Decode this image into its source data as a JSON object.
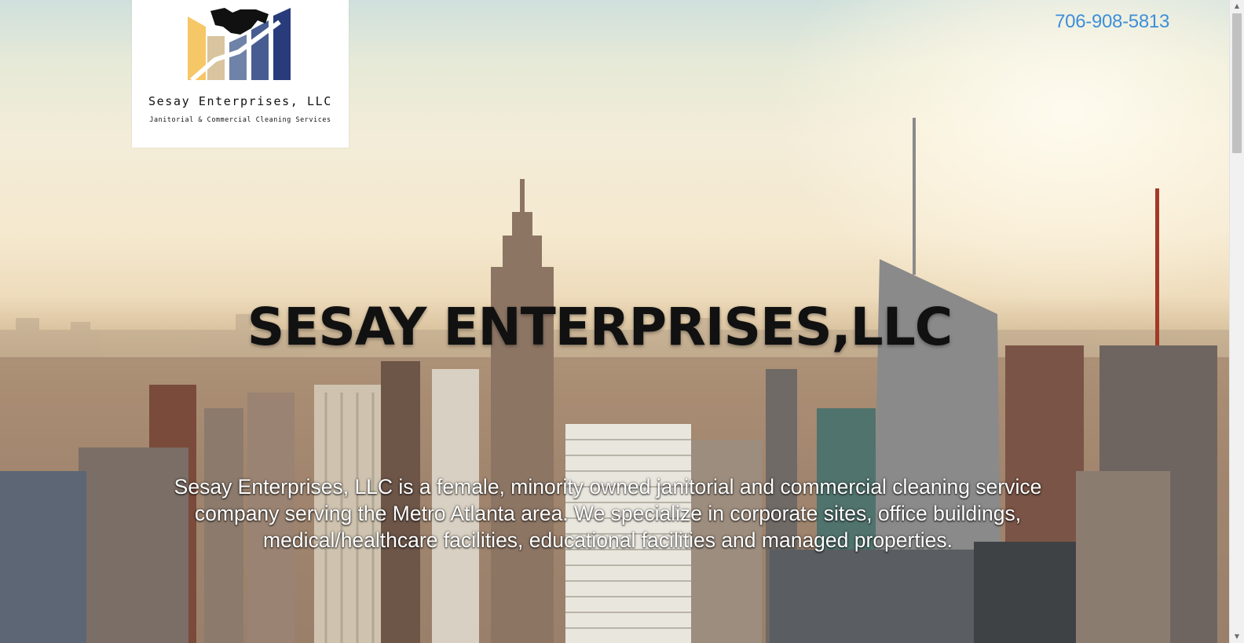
{
  "header": {
    "logo": {
      "company_name": "Sesay Enterprises, LLC",
      "tagline": "Janitorial & Commercial Cleaning Services",
      "icon": "handshake-icon",
      "colors": [
        "#f6c766",
        "#d8c49e",
        "#6f82a8",
        "#475d92",
        "#283b7a"
      ]
    },
    "phone": "706-908-5813"
  },
  "hero": {
    "headline": "SESAY ENTERPRISES,LLC",
    "description": "Sesay Enterprises, LLC is a female, minority owned janitorial and commercial  cleaning service company serving the Metro Atlanta area. We specialize in corporate sites, office buildings, medical/healthcare facilities, educational facilities and managed properties.",
    "background": "city-skyline-image"
  },
  "scrollbar": {
    "up_icon": "scroll-up-arrow-icon",
    "down_icon": "scroll-down-arrow-icon"
  },
  "colors": {
    "phone_link": "#3d8fd9",
    "headline": "#111111",
    "description": "#ffffff"
  }
}
